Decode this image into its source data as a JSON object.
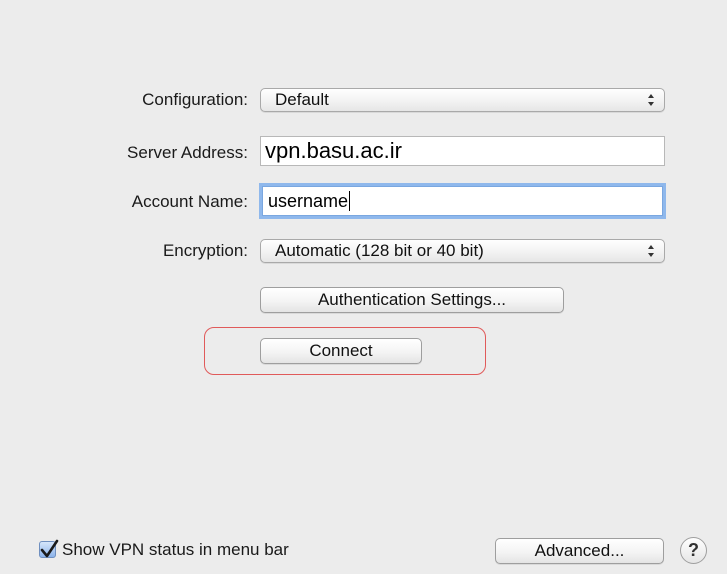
{
  "form": {
    "configuration_label": "Configuration:",
    "configuration_value": "Default",
    "server_label": "Server Address:",
    "server_value": "vpn.basu.ac.ir",
    "account_label": "Account Name:",
    "account_value": "username",
    "encryption_label": "Encryption:",
    "encryption_value": "Automatic (128 bit or 40 bit)"
  },
  "buttons": {
    "auth_settings": "Authentication Settings...",
    "connect": "Connect",
    "advanced": "Advanced...",
    "help": "?"
  },
  "footer": {
    "show_status_label": "Show VPN status in menu bar",
    "show_status_checked": true
  },
  "colors": {
    "highlight": "#e05a5a",
    "focus_ring": "#8fb8ec"
  },
  "icons": {
    "popup_arrows": "up-down-arrows-icon",
    "checkmark": "checkmark-icon"
  }
}
